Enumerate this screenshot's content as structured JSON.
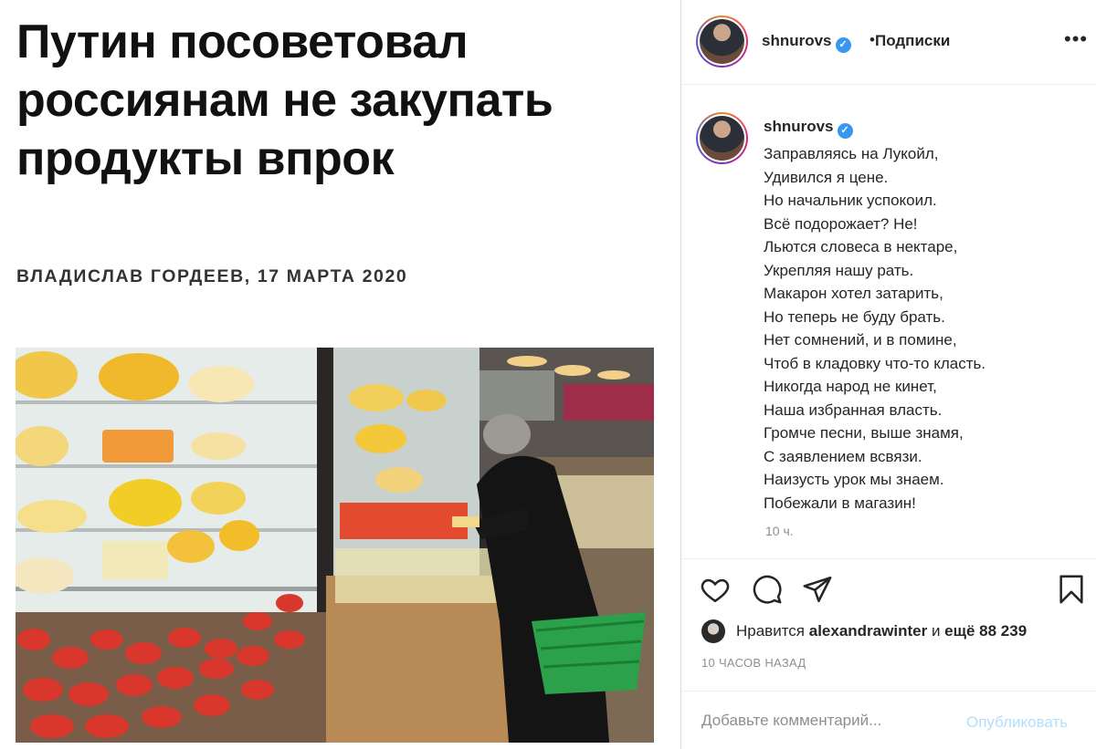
{
  "article": {
    "headline": "Путин посоветовал россиянам не закупать продукты впрок",
    "byline": "ВЛАДИСЛАВ ГОРДЕЕВ, 17 МАРТА 2020"
  },
  "header": {
    "username": "shnurovs",
    "separator": "•",
    "follow_label": "Подписки",
    "more_icon": "more-icon"
  },
  "caption": {
    "username": "shnurovs",
    "text": "Заправляясь на Лукойл,\nУдивился я цене.\nНо начальник успокоил.\nВсё подорожает? Не!\nЛьются словеса в нектаре,\nУкрепляя нашу рать.\nМакарон хотел затарить,\nНо теперь не буду брать.\nНет сомнений, и в помине,\nЧтоб в кладовку что-то класть.\nНикогда народ не кинет,\nНаша избранная власть.\nГромче песни, выше знамя,\nС заявлением всвязи.\nНаизусть урок мы знаем.\nПобежали в магазин!",
    "time": "10 ч."
  },
  "actions": {
    "icons": [
      "heart-icon",
      "comment-icon",
      "share-icon",
      "bookmark-icon"
    ]
  },
  "likes": {
    "prefix": "Нравится",
    "user": "alexandrawinter",
    "conjunction": "и",
    "count": "ещё 88 239"
  },
  "posted_ago": "10 ЧАСОВ НАЗАД",
  "comment": {
    "placeholder": "Добавьте комментарий...",
    "value": "",
    "publish_label": "Опубликовать"
  },
  "colors": {
    "verified": "#3897f0",
    "publish_disabled": "#b2dffc",
    "muted": "#8e8e8e"
  }
}
